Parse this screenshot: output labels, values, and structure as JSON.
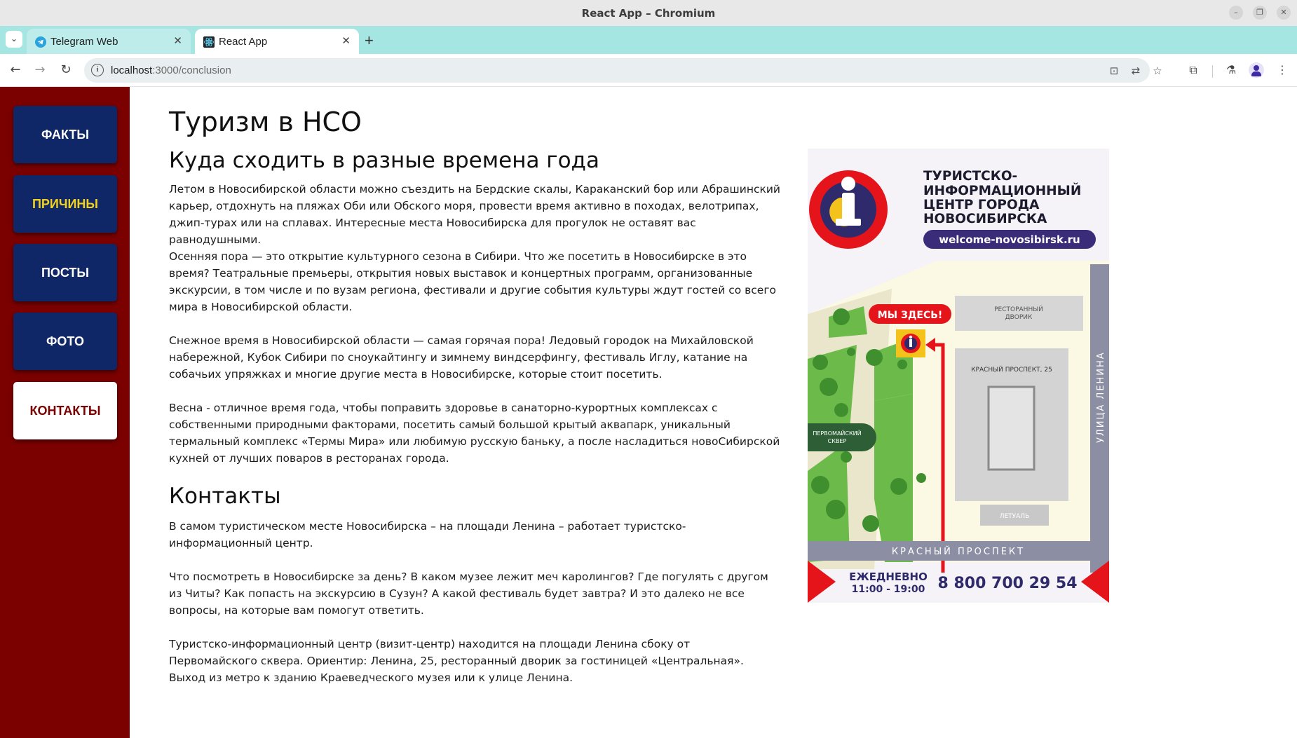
{
  "window": {
    "title": "React App – Chromium"
  },
  "tabs": [
    {
      "label": "Telegram Web",
      "active": false
    },
    {
      "label": "React App",
      "active": true
    }
  ],
  "address_bar": {
    "host": "localhost",
    "path": ":3000/conclusion"
  },
  "sidebar": {
    "items": [
      {
        "label": "ФАКТЫ"
      },
      {
        "label": "ПРИЧИНЫ"
      },
      {
        "label": "ПОСТЫ"
      },
      {
        "label": "ФОТО"
      },
      {
        "label": "КОНТАКТЫ"
      }
    ]
  },
  "main": {
    "title": "Туризм в НСО",
    "seasons_heading": "Куда сходить в разные времена года",
    "seasons_paragraphs": [
      "Летом в Новосибирской области можно съездить на Бердские скалы, Караканский бор или Абрашинский карьер, отдохнуть на пляжах Оби или Обского моря, провести время активно в походах, велотрипах, джип-турах или на сплавах. Интересные места Новосибирска для прогулок не оставят вас равнодушными.",
      "Осенняя пора — это открытие культурного сезона в Сибири. Что же посетить в Новосибирске в это время? Театральные премьеры, открытия новых выставок и концертных программ, организованные экскурсии, в том числе и по вузам региона, фестивали и другие события культуры ждут гостей со всего мира в Новосибирской области.",
      "Снежное время в Новосибирской области — самая горячая пора! Ледовый городок на Михайловской набережной, Кубок Сибири по сноукайтингу и зимнему виндсерфингу, фестиваль Иглу, катание на собачьих упряжках и многие другие места в Новосибирске, которые стоит посетить.",
      "Весна - отличное время года, чтобы поправить здоровье в санаторно-курортных комплексах с собственными природными факторами, посетить самый большой крытый аквапарк, уникальный термальный комплекс «Термы Мира» или любимую русскую баньку, а после насладиться новоСибирской кухней от лучших поваров в ресторанах города."
    ],
    "contacts_heading": "Контакты",
    "contacts_paragraphs": [
      "В самом туристическом месте Новосибирска – на площади Ленина – работает туристско-информационный центр.",
      "Что посмотреть в Новосибирске за день? В каком музее лежит меч каролингов? Где погулять с другом из Читы? Как попасть на экскурсию в Сузун? А какой фестиваль будет завтра? И это далеко не все вопросы, на которые вам помогут ответить.",
      "Туристско-информационный центр (визит-центр) находится на площади Ленина сбоку от Первомайского сквера. Ориентир: Ленина, 25, ресторанный дворик за гостиницей «Центральная». Выход из метро к зданию Краеведческого музея или к улице Ленина."
    ]
  },
  "poster": {
    "org_name_lines": [
      "ТУРИСТСКО-",
      "ИНФОРМАЦИОННЫЙ",
      "ЦЕНТР ГОРОДА",
      "НОВОСИБИРСКА"
    ],
    "website": "welcome-novosibirsk.ru",
    "you_are_here": "МЫ ЗДЕСЬ!",
    "food_court_lines": [
      "РЕСТОРАННЫЙ",
      "ДВОРИК"
    ],
    "building_label": "КРАСНЫЙ ПРОСПЕКТ, 25",
    "shop_label": "ЛЕТУАЛЬ",
    "square_label_lines": [
      "ПЕРВОМАЙСКИЙ",
      "СКВЕР"
    ],
    "street_right": "УЛИЦА ЛЕНИНА",
    "street_bottom": "КРАСНЫЙ ПРОСПЕКТ",
    "schedule_label": "ЕЖЕДНЕВНО",
    "schedule_hours": "11:00 - 19:00",
    "phone": "8 800 700 29 54",
    "colors": {
      "red": "#e5141b",
      "navy": "#2f2a6b",
      "purple": "#3b2c79",
      "green": "#6cbb4a",
      "street": "#8c8fa3"
    }
  }
}
